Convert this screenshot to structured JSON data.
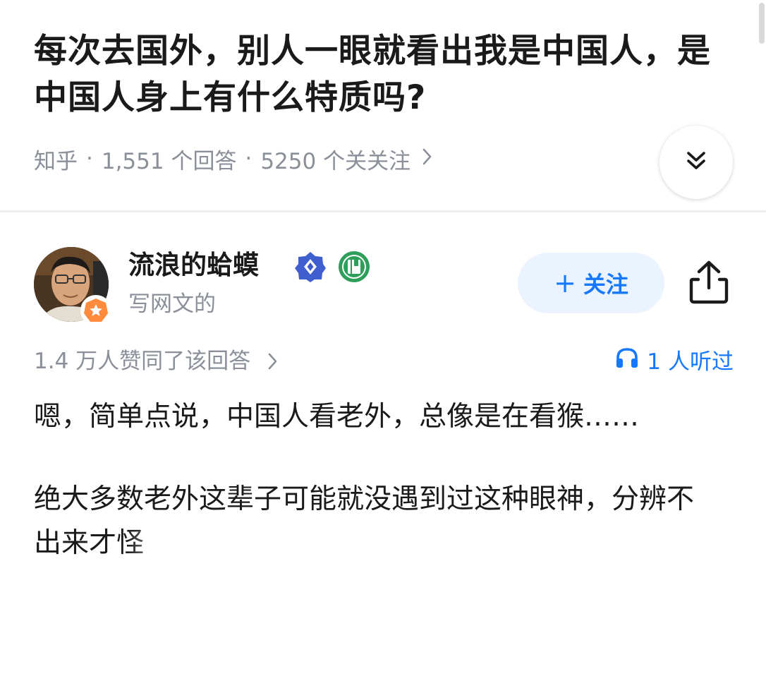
{
  "question": {
    "title": "每次去国外，别人一眼就看出我是中国人，是中国人身上有什么特质吗?",
    "source": "知乎",
    "answer_count": "1,551 个回答",
    "follow_count": "5250 个关关注"
  },
  "author": {
    "name": "流浪的蛤蟆",
    "description": "写网文的",
    "follow_label": "关注",
    "follow_plus": "+"
  },
  "stats": {
    "likes": "1.4 万人赞同了该回答",
    "listen_count": "1",
    "listen_suffix": "人听过"
  },
  "answer": {
    "paragraphs": [
      "嗯，简单点说，中国人看老外，总像是在看猴……",
      "绝大多数老外这辈子可能就没遇到过这种眼神，分辨不出来才怪"
    ]
  },
  "icons": {
    "expand": "chevron-double-down-icon",
    "share": "share-icon",
    "headphones": "headphones-icon",
    "vip": "diamond-badge-icon",
    "book": "book-badge-icon",
    "star": "star-badge-icon"
  },
  "colors": {
    "accent": "#1677ff",
    "follow_bg": "#ebf4fe",
    "secondary_text": "#8a8f99",
    "primary_text": "#1a1a1a"
  }
}
